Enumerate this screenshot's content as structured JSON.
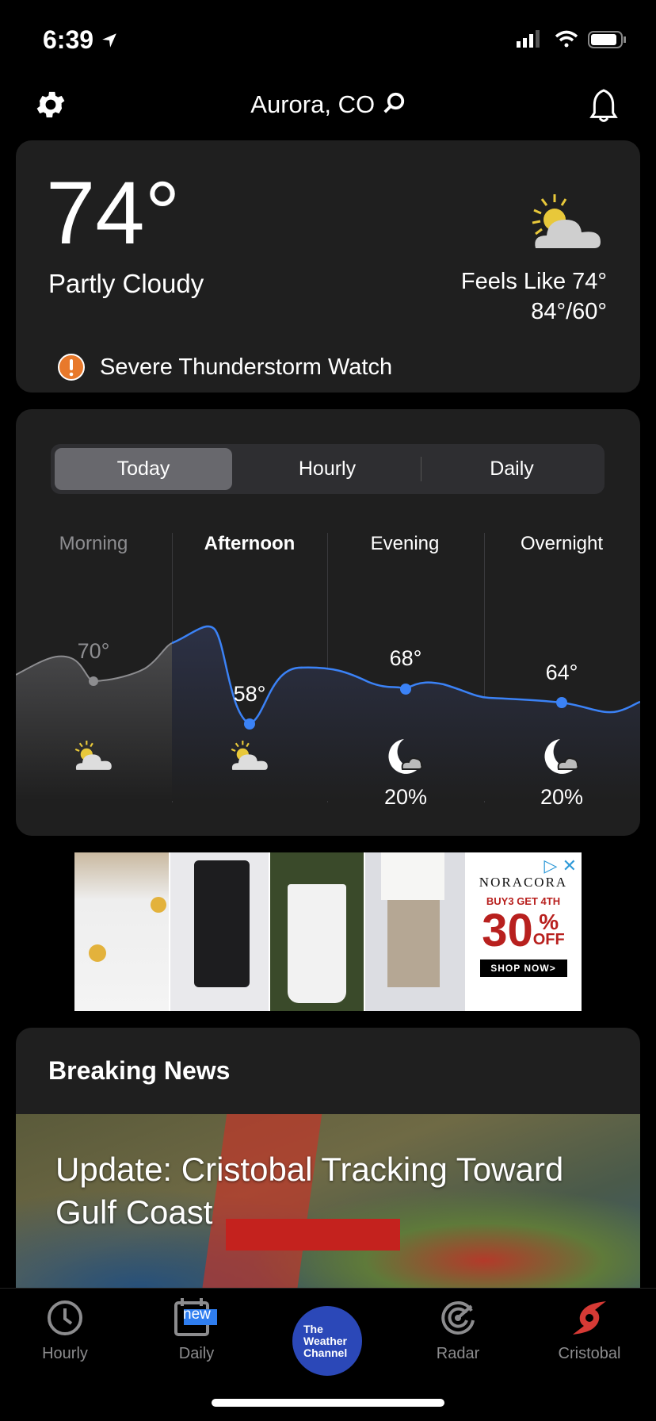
{
  "status_bar": {
    "time": "6:39"
  },
  "header": {
    "location": "Aurora, CO"
  },
  "current": {
    "temperature": "74°",
    "condition": "Partly Cloudy",
    "feels_like": "Feels Like 74°",
    "high_low": "84°/60°",
    "alert": "Severe Thunderstorm Watch",
    "alert_color": "#e8792b",
    "icon": "partly-cloudy-icon"
  },
  "forecast": {
    "tabs": [
      {
        "label": "Today",
        "active": true
      },
      {
        "label": "Hourly",
        "active": false
      },
      {
        "label": "Daily",
        "active": false
      }
    ],
    "periods": [
      {
        "label": "Morning",
        "temp": "70°",
        "icon": "partly-cloudy-icon",
        "precip": "",
        "past": true
      },
      {
        "label": "Afternoon",
        "temp": "58°",
        "icon": "partly-cloudy-icon",
        "precip": "",
        "current": true
      },
      {
        "label": "Evening",
        "temp": "68°",
        "icon": "moon-cloud-icon",
        "precip": "20%"
      },
      {
        "label": "Overnight",
        "temp": "64°",
        "icon": "moon-cloud-icon",
        "precip": "20%"
      }
    ],
    "line_color": "#3b82f6"
  },
  "ad": {
    "brand": "NORACORA",
    "offer": "BUY3 GET 4TH",
    "discount": "30",
    "percent": "%",
    "off": "OFF",
    "cta": "SHOP NOW>"
  },
  "news": {
    "section_title": "Breaking News",
    "headline": "Update: Cristobal Tracking Toward Gulf Coast"
  },
  "tab_bar": {
    "items": [
      {
        "label": "Hourly"
      },
      {
        "label": "Daily",
        "badge": "new"
      },
      {
        "label": "The Weather Channel"
      },
      {
        "label": "Radar"
      },
      {
        "label": "Cristobal"
      }
    ],
    "brand_color": "#2b48b8",
    "storm_color": "#d63a35"
  }
}
